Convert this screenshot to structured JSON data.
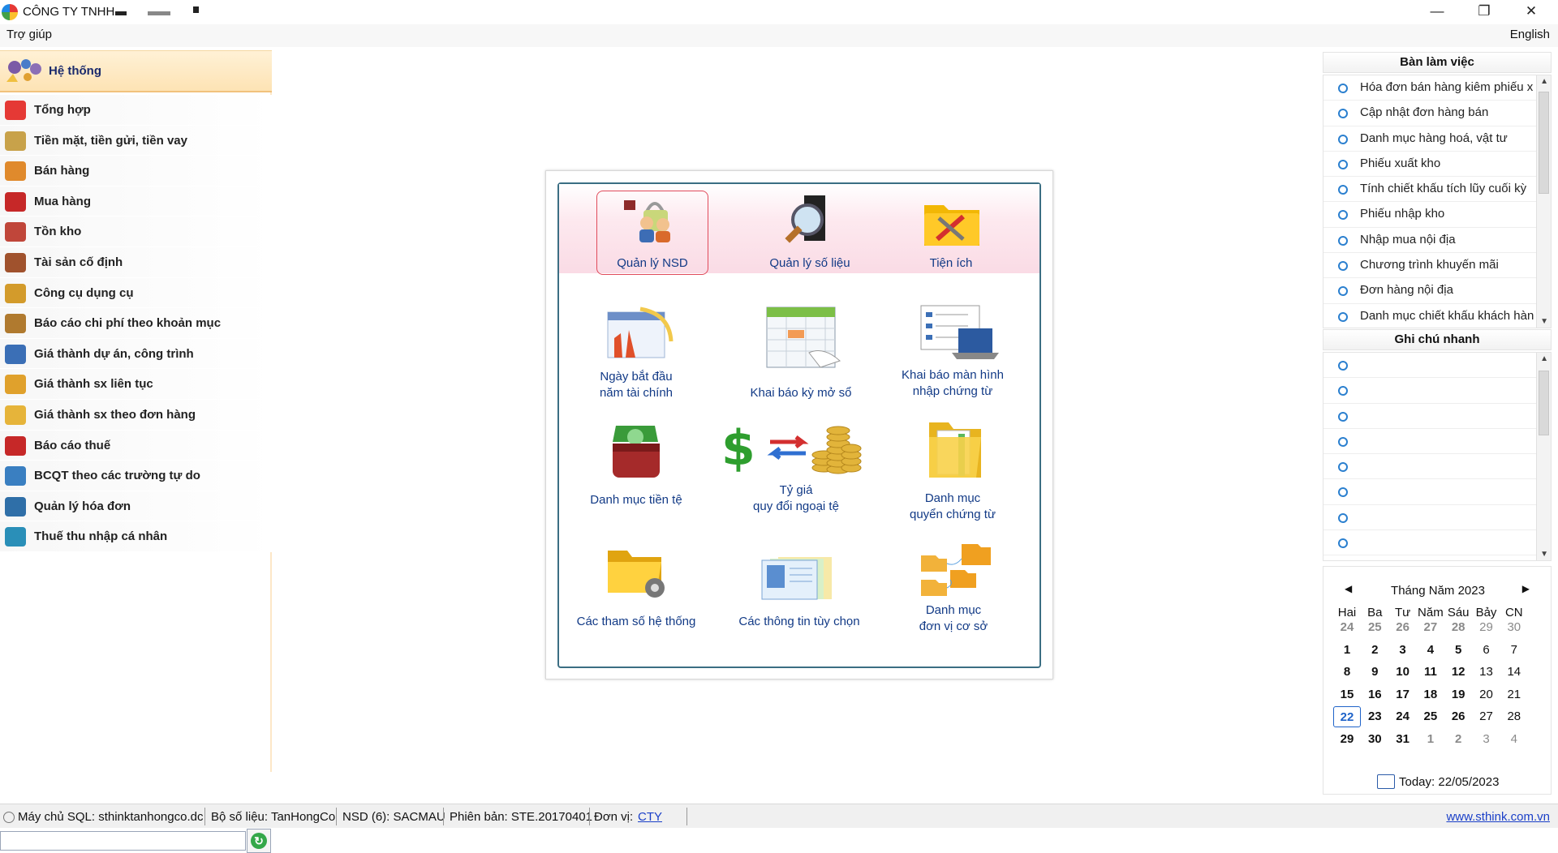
{
  "window": {
    "title": "CÔNG TY TNHH",
    "minimize": "—",
    "restore": "❐",
    "close": "✕"
  },
  "menu": {
    "help": "Trợ giúp",
    "language": "English"
  },
  "sidebar": {
    "header": "Hệ thống",
    "items": [
      {
        "label": "Tổng hợp",
        "icon": "summary-icon",
        "color": "#e53935"
      },
      {
        "label": "Tiền mặt, tiền gửi, tiền vay",
        "icon": "scale-icon",
        "color": "#c8a24a"
      },
      {
        "label": "Bán hàng",
        "icon": "sales-icon",
        "color": "#e08a2c"
      },
      {
        "label": "Mua hàng",
        "icon": "cart-icon",
        "color": "#c62828"
      },
      {
        "label": "Tồn kho",
        "icon": "warehouse-icon",
        "color": "#c0463a"
      },
      {
        "label": "Tài sản cố định",
        "icon": "asset-icon",
        "color": "#a0522d"
      },
      {
        "label": "Công cụ dụng cụ",
        "icon": "tools-icon",
        "color": "#d39b2b"
      },
      {
        "label": "Báo cáo chi phí theo khoản mục",
        "icon": "cost-report-icon",
        "color": "#b07a2f"
      },
      {
        "label": "Giá thành dự án, công trình",
        "icon": "project-cost-icon",
        "color": "#3b6fb6"
      },
      {
        "label": "Giá thành sx liên tục",
        "icon": "continuous-cost-icon",
        "color": "#e0a12c"
      },
      {
        "label": "Giá thành sx theo đơn hàng",
        "icon": "order-cost-icon",
        "color": "#e6b43a"
      },
      {
        "label": "Báo cáo thuế",
        "icon": "tax-icon",
        "color": "#c62828"
      },
      {
        "label": "BCQT theo các trường tự do",
        "icon": "custom-report-icon",
        "color": "#3a7fc1"
      },
      {
        "label": "Quản lý hóa đơn",
        "icon": "invoice-icon",
        "color": "#2f6fa8"
      },
      {
        "label": "Thuế thu nhập cá nhân",
        "icon": "personal-tax-icon",
        "color": "#2a8fb8"
      }
    ],
    "search_value": "",
    "go_glyph": "↻"
  },
  "panel": {
    "top": [
      {
        "label": "Quản lý NSD",
        "icon": "user-management-icon"
      },
      {
        "label": "Quản lý số liệu",
        "icon": "data-management-icon"
      },
      {
        "label": "Tiện ích",
        "icon": "utilities-icon"
      }
    ],
    "tiles": [
      {
        "line1": "Ngày bắt đầu",
        "line2": "năm tài chính",
        "icon": "fiscal-year-icon"
      },
      {
        "line1": "Khai báo kỳ mở sổ",
        "line2": "",
        "icon": "ledger-calendar-icon"
      },
      {
        "line1": "Khai báo màn hình",
        "line2": "nhập chứng từ",
        "icon": "screen-config-icon"
      },
      {
        "line1": "Danh mục tiền tệ",
        "line2": "",
        "icon": "currency-icon"
      },
      {
        "line1": "Tỷ giá",
        "line2": "quy đổi ngoại tệ",
        "icon": "exchange-rate-icon"
      },
      {
        "line1": "Danh mục",
        "line2": "quyển chứng từ",
        "icon": "document-book-icon"
      },
      {
        "line1": "Các tham số hệ thống",
        "line2": "",
        "icon": "system-settings-icon"
      },
      {
        "line1": "Các thông tin tùy chọn",
        "line2": "",
        "icon": "options-icon"
      },
      {
        "line1": "Danh mục",
        "line2": "đơn vị cơ sở",
        "icon": "units-icon"
      }
    ]
  },
  "workspace": {
    "title": "Bàn làm việc",
    "items": [
      "Hóa đơn bán hàng kiêm phiếu x",
      "Cập nhật đơn hàng bán",
      "Danh mục hàng hoá, vật tư",
      "Phiếu xuất kho",
      "Tính chiết khấu tích lũy cuối kỳ",
      "Phiếu nhập kho",
      "Nhập mua nội địa",
      "Chương trình khuyến mãi",
      "Đơn hàng nội địa",
      "Danh mục chiết khấu khách hàn"
    ]
  },
  "notes": {
    "title": "Ghi chú nhanh",
    "count": 8
  },
  "calendar": {
    "title": "Tháng Năm 2023",
    "prev": "◀",
    "next": "▶",
    "weekdays": [
      "Hai",
      "Ba",
      "Tư",
      "Năm",
      "Sáu",
      "Bảy",
      "CN"
    ],
    "weeks": [
      [
        "24",
        "25",
        "26",
        "27",
        "28",
        "29",
        "30"
      ],
      [
        "1",
        "2",
        "3",
        "4",
        "5",
        "6",
        "7"
      ],
      [
        "8",
        "9",
        "10",
        "11",
        "12",
        "13",
        "14"
      ],
      [
        "15",
        "16",
        "17",
        "18",
        "19",
        "20",
        "21"
      ],
      [
        "22",
        "23",
        "24",
        "25",
        "26",
        "27",
        "28"
      ],
      [
        "29",
        "30",
        "31",
        "1",
        "2",
        "3",
        "4"
      ]
    ],
    "selected": "22",
    "today_label": "Today: 22/05/2023"
  },
  "status": {
    "server": "Máy chủ SQL: sthinktanhongco.dc",
    "database": "Bộ số liệu: TanHongCo",
    "user": "NSD (6): SACMAU",
    "version": "Phiên bản: STE.20170401",
    "unit_label": "Đơn vị:",
    "unit_value": "CTY",
    "website": "www.sthink.com.vn"
  }
}
